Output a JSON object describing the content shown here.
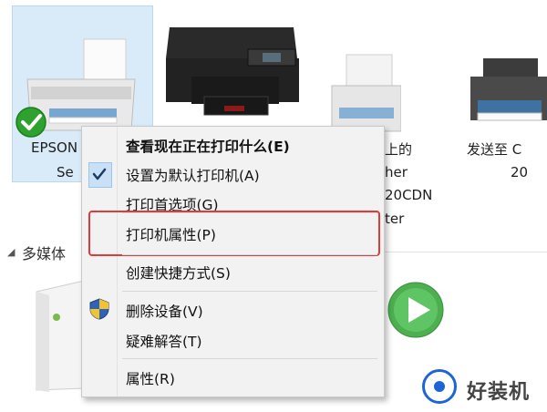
{
  "devices": [
    {
      "name_line1": "EPSON",
      "name_line2": "Se",
      "selected": true,
      "status_icon": "green-check-icon"
    },
    {
      "name_line1": "",
      "name_line2": "",
      "selected": false
    },
    {
      "name_line1": "上的",
      "name_line2": "her",
      "name_line3": "20CDN",
      "name_line4": "ter",
      "selected": false
    },
    {
      "name_line1": "发送至 C",
      "name_line2": "20",
      "selected": false
    }
  ],
  "section": {
    "label": "多媒体"
  },
  "context_menu": {
    "items": [
      {
        "label": "查看现在正在打印什么(E)",
        "bold": true
      },
      {
        "label": "设置为默认打印机(A)",
        "checked": true
      },
      {
        "label": "打印首选项(G)"
      },
      {
        "label": "打印机属性(P)",
        "highlighted": true
      },
      {
        "label": "创建快捷方式(S)"
      },
      {
        "label": "删除设备(V)",
        "icon": "shield-icon"
      },
      {
        "label": "疑难解答(T)"
      },
      {
        "label": "属性(R)"
      }
    ],
    "highlight_color": "#e03b3b"
  },
  "watermark": {
    "text": "好装机"
  },
  "colors": {
    "selection": "#d9ebf9",
    "accent_blue": "#1e64d6",
    "play_green": "#4caf50"
  }
}
